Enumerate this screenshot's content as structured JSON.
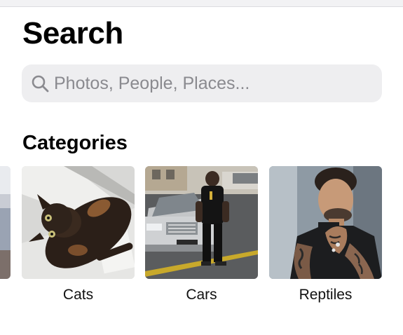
{
  "header": {
    "title": "Search"
  },
  "search": {
    "placeholder": "Photos, People, Places..."
  },
  "categories": {
    "title": "Categories",
    "items": [
      {
        "label": "Cats"
      },
      {
        "label": "Cars"
      },
      {
        "label": "Reptiles"
      }
    ]
  },
  "icons": {
    "search": "search-icon"
  },
  "colors": {
    "search_bg": "#eeeef0",
    "placeholder": "#8a8a8f",
    "text": "#000000"
  }
}
